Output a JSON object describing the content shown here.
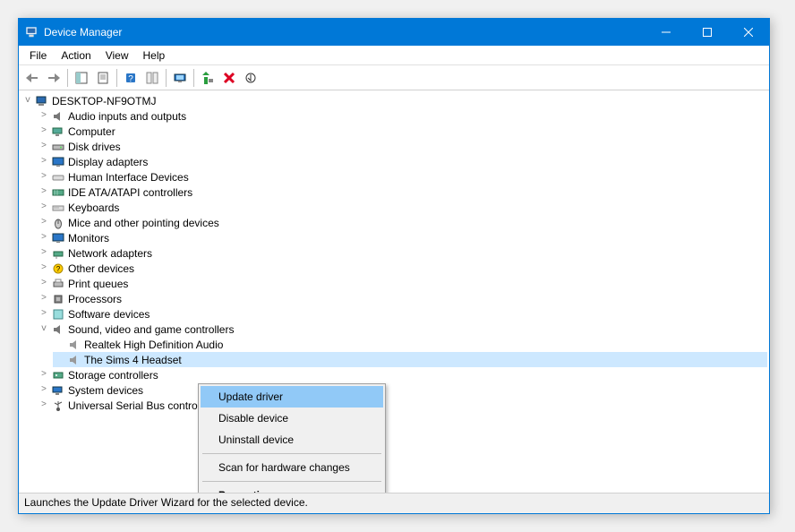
{
  "window": {
    "title": "Device Manager"
  },
  "menubar": {
    "file": "File",
    "action": "Action",
    "view": "View",
    "help": "Help"
  },
  "tree": {
    "root": "DESKTOP-NF9OTMJ",
    "cats": {
      "audio": "Audio inputs and outputs",
      "computer": "Computer",
      "disk": "Disk drives",
      "display": "Display adapters",
      "hid": "Human Interface Devices",
      "ide": "IDE ATA/ATAPI controllers",
      "keyboards": "Keyboards",
      "mice": "Mice and other pointing devices",
      "monitors": "Monitors",
      "network": "Network adapters",
      "other": "Other devices",
      "printq": "Print queues",
      "processors": "Processors",
      "software": "Software devices",
      "sound": "Sound, video and game controllers",
      "storage": "Storage controllers",
      "system": "System devices",
      "usb": "Universal Serial Bus controllers"
    },
    "sound_items": {
      "realtek": "Realtek High Definition Audio",
      "sims": "The Sims 4 Headset"
    }
  },
  "context": {
    "update": "Update driver",
    "disable": "Disable device",
    "uninstall": "Uninstall device",
    "scan": "Scan for hardware changes",
    "properties": "Properties"
  },
  "statusbar": {
    "text": "Launches the Update Driver Wizard for the selected device."
  }
}
